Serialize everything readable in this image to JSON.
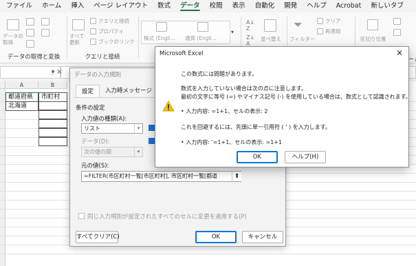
{
  "ribbon": {
    "tabs": [
      "ファイル",
      "ホーム",
      "挿入",
      "ページ レイアウト",
      "数式",
      "データ",
      "校閲",
      "表示",
      "自動化",
      "開発",
      "ヘルプ",
      "Acrobat",
      "新しいタブ"
    ],
    "active_tab": "データ",
    "groups": {
      "get_data": {
        "label": "データの取得と変換",
        "get_data_btn": "データの\n取得",
        "small": [
          "",
          "",
          ""
        ]
      },
      "queries": {
        "label": "クエリと接続",
        "refresh_btn": "すべて\n更新",
        "items": [
          "クエリと接続",
          "プロパティ",
          "ブックのリンク"
        ]
      },
      "data_types": {
        "stocks": "株式 (Engli...",
        "currency": "通貨 (Engli..."
      },
      "sort": {
        "sort_btn": "並べ替え"
      },
      "filter": {
        "filter_btn": "フィルター",
        "clear": "クリア",
        "reapply": "再適用",
        "advanced": "詳細設定"
      },
      "tools": {
        "flash_fill": "区切り位置"
      },
      "outline": {
        "label": "ール"
      }
    }
  },
  "sheet": {
    "columns": [
      "A",
      "B"
    ],
    "cells": {
      "a1": "都道府県",
      "b1": "市町村",
      "a2": "北海道"
    }
  },
  "data_validation": {
    "title": "データの入力規則",
    "tabs": [
      "設定",
      "入力時メッセージ"
    ],
    "section_label": "条件の設定",
    "allow_label": "入力値の種類(A):",
    "allow_value": "リスト",
    "data_label": "データ(D):",
    "data_value": "次の値の間",
    "source_label": "元の値(S):",
    "source_value": "=FILTER(市区町村一覧[市区町村], 市区町村一覧[都道",
    "apply_all_label": "同じ入力規則が設定されたすべてのセルに変更を適用する(P)",
    "clear_all_btn": "すべてクリア(C)",
    "ok_btn": "OK",
    "cancel_btn": "キャンセル"
  },
  "message_box": {
    "title": "Microsoft Excel",
    "line1": "この数式には問題があります。",
    "line2": "数式を入力していない場合は次の点に注意します。",
    "line3": "最初の文字に等号 (=) やマイナス記号 (-) を使用している場合は、数式として認識されます。",
    "line4": "• 入力内容: =1+1、セルの表示: 2",
    "line5": "これを回避するには、先頭に単一引用符 ( ' ) を入力します。",
    "line6": "• 入力内容: '=1+1、セルの表示: =1+1",
    "ok_btn": "OK",
    "help_btn": "ヘルプ(H)",
    "icon": "warning-icon"
  },
  "colors": {
    "accent_green": "#1e7145",
    "warning_yellow": "#f5c400",
    "focus_blue": "#0078d4"
  }
}
